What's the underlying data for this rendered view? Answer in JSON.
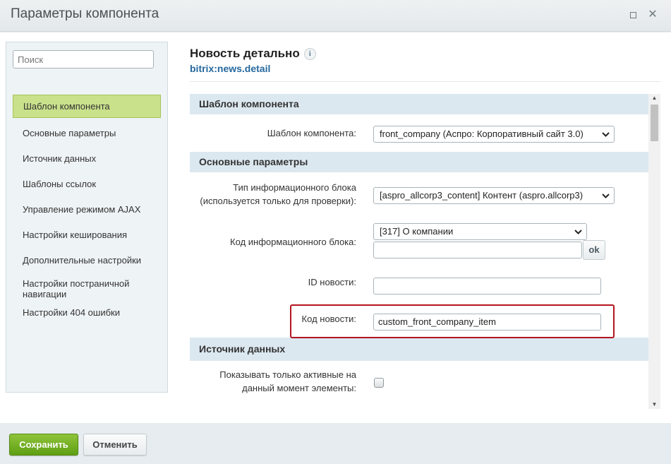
{
  "window": {
    "title": "Параметры компонента"
  },
  "sidebar": {
    "search_placeholder": "Поиск",
    "items": [
      {
        "label": "Шаблон компонента"
      },
      {
        "label": "Основные параметры"
      },
      {
        "label": "Источник данных"
      },
      {
        "label": "Шаблоны ссылок"
      },
      {
        "label": "Управление режимом AJAX"
      },
      {
        "label": "Настройки кеширования"
      },
      {
        "label": "Дополнительные настройки"
      },
      {
        "label": "Настройки постраничной навигации"
      },
      {
        "label": "Настройки 404 ошибки"
      }
    ]
  },
  "component": {
    "title": "Новость детально",
    "code": "bitrix:news.detail",
    "info_icon": "i"
  },
  "sections": {
    "template": "Шаблон компонента",
    "main": "Основные параметры",
    "source": "Источник данных"
  },
  "fields": {
    "template_label": "Шаблон компонента:",
    "template_value": "front_company (Аспро: Корпоративный сайт 3.0)",
    "iblock_type_label": "Тип информационного блока (используется только для проверки):",
    "iblock_type_value": "[aspro_allcorp3_content] Контент (aspro.allcorp3)",
    "iblock_code_label": "Код информационного блока:",
    "iblock_code_value": "[317] О компании",
    "iblock_code_input": "",
    "ok_label": "ok",
    "news_id_label": "ID новости:",
    "news_id_value": "",
    "news_code_label": "Код новости:",
    "news_code_value": "custom_front_company_item",
    "active_only_label": "Показывать только активные на данный момент элементы:"
  },
  "footer": {
    "save_label": "Сохранить",
    "cancel_label": "Отменить"
  },
  "colors": {
    "active_nav": "#c9e18b",
    "save_button": "#6aa81e",
    "highlight_border": "#b3151f",
    "section_bg": "#dce8f0",
    "link": "#25689e"
  }
}
